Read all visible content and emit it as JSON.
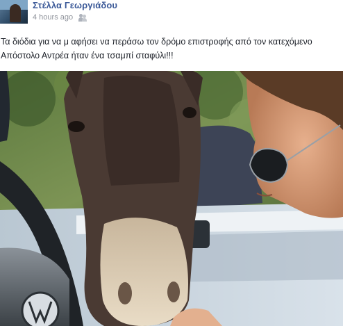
{
  "post": {
    "author": "Στέλλα Γεωργιάδου",
    "timestamp": "4 hours ago",
    "text": "Τα διόδια για να μ αφήσει να περάσω τον δρόμο επιστροφής από τον κατεχόμενο Απόστολο Αντρέα ήταν ένα τσαμπί σταφύλι!!!",
    "audience_icon": "friends-icon"
  },
  "photo": {
    "subject_icons": [
      "donkey",
      "woman-with-sunglasses",
      "car-steering-wheel"
    ]
  }
}
